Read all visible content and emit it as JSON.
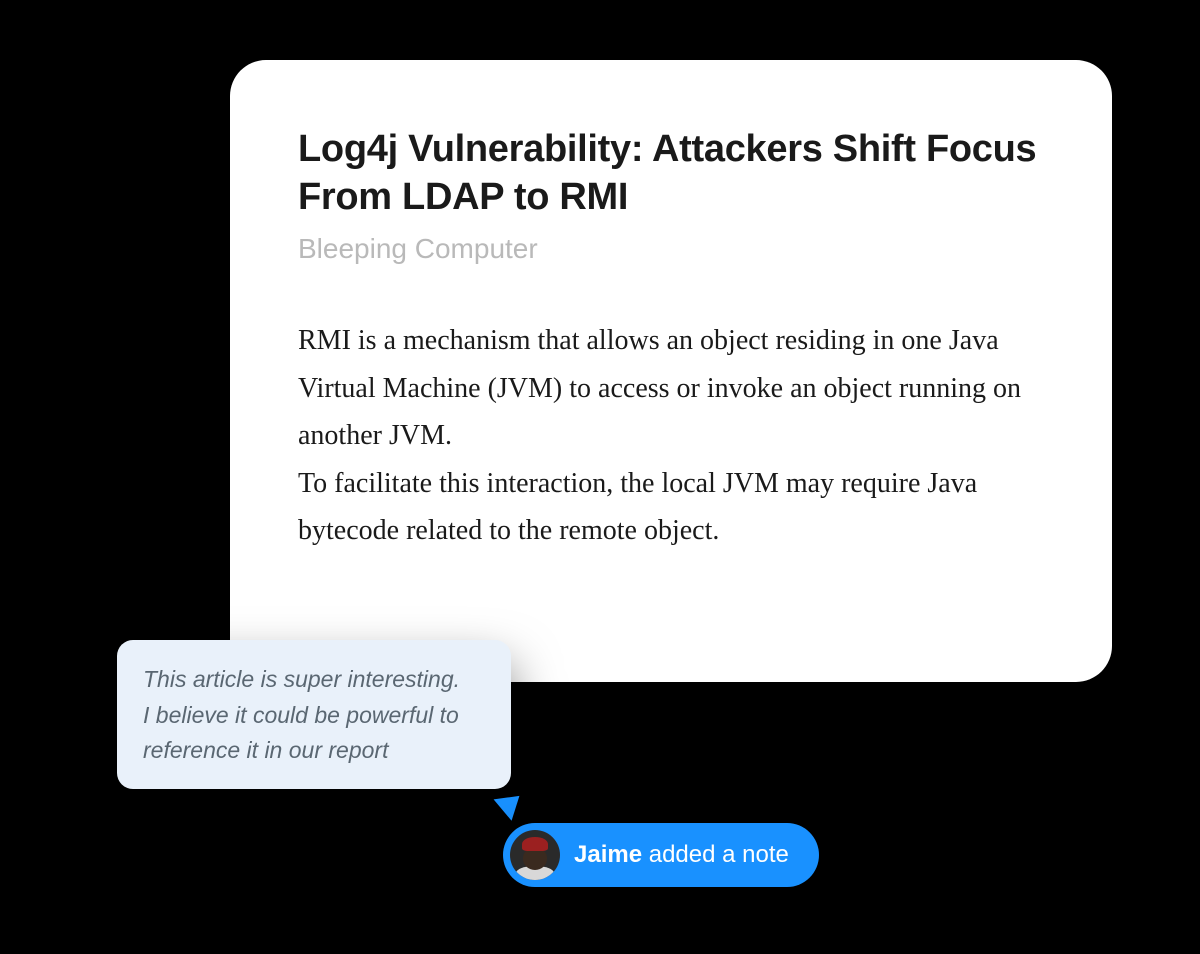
{
  "article": {
    "title": "Log4j Vulnerability: Attackers Shift Focus From LDAP to RMI",
    "source": "Bleeping Computer",
    "body": "RMI is a mechanism that allows an object residing in one Java Virtual Machine (JVM) to access or invoke an object running on another JVM.\nTo facilitate this interaction, the local JVM may require Java bytecode related to the remote object."
  },
  "note": {
    "text": "This article is super interesting.\nI believe it could be powerful to reference it in our report"
  },
  "notification": {
    "user": "Jaime",
    "action": " added a note"
  }
}
